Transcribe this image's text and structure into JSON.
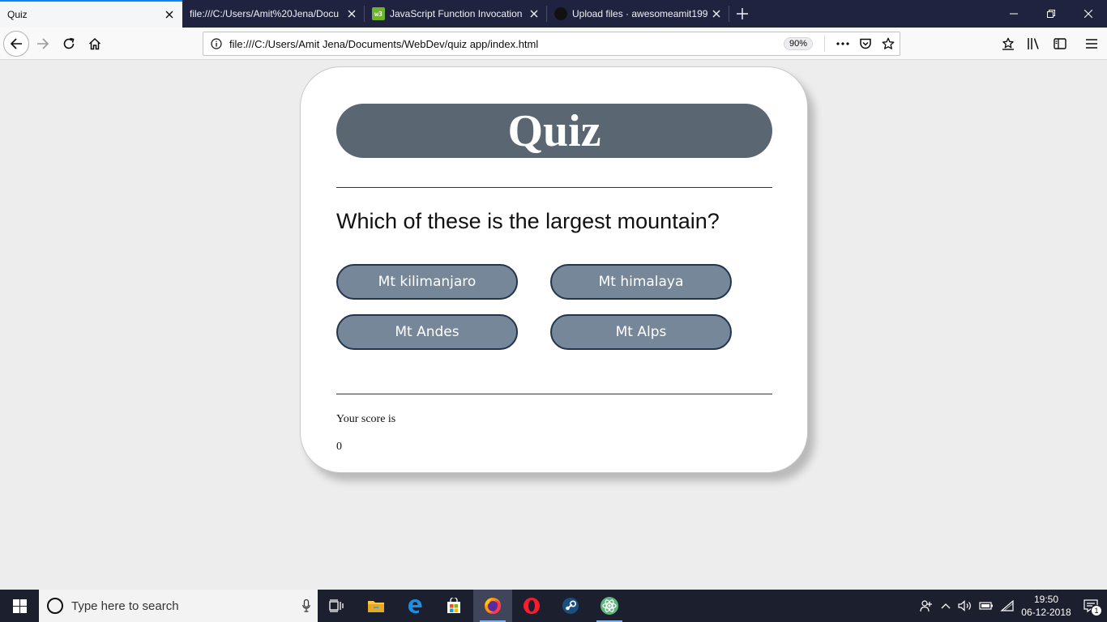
{
  "tabs": [
    {
      "title": "Quiz",
      "active": true
    },
    {
      "title": "file:///C:/Users/Amit%20Jena/Docu",
      "active": false
    },
    {
      "title": "JavaScript Function Invocation",
      "active": false
    },
    {
      "title": "Upload files · awesomeamit199",
      "active": false
    }
  ],
  "urlbar": {
    "url": "file:///C:/Users/Amit Jena/Documents/WebDev/quiz app/index.html",
    "zoom": "90%"
  },
  "quiz": {
    "title": "Quiz",
    "question": "Which of these is the largest mountain?",
    "answers": [
      "Mt kilimanjaro",
      "Mt himalaya",
      "Mt Andes",
      "Mt Alps"
    ],
    "score_label": "Your score is",
    "score": "0"
  },
  "taskbar": {
    "search_placeholder": "Type here to search",
    "time": "19:50",
    "date": "06-12-2018",
    "notification_count": "1"
  },
  "colors": {
    "tabstrip": "#202340",
    "accent": "#0a84ff",
    "quiz_header": "#5a6672",
    "answer_button": "#77879a",
    "answer_border": "#23354d"
  }
}
